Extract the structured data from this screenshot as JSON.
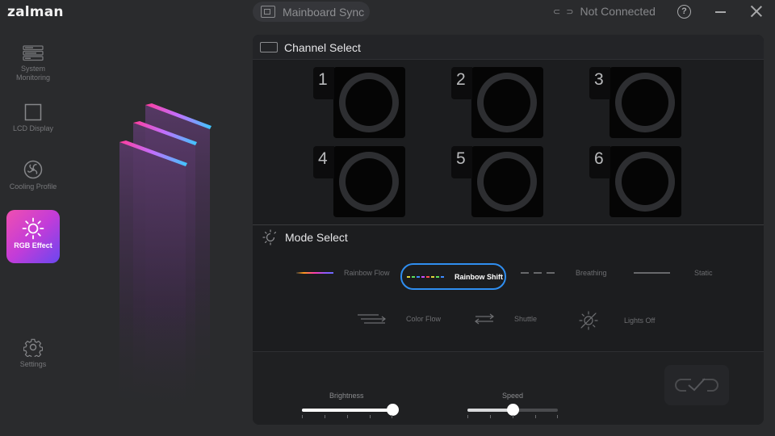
{
  "app": {
    "logo": "zalman",
    "center_title": "Mainboard Sync",
    "connection_status": "Not Connected"
  },
  "sidebar": {
    "items": [
      {
        "label": "System Monitoring",
        "icon": "monitor-bars-icon"
      },
      {
        "label": "LCD Display",
        "icon": "square-icon"
      },
      {
        "label": "Cooling Profile",
        "icon": "fan-icon"
      },
      {
        "label": "RGB Effect",
        "icon": "sun-icon",
        "active": true
      },
      {
        "label": "Settings",
        "icon": "gear-icon"
      }
    ]
  },
  "channel_select": {
    "title": "Channel Select",
    "channels": [
      "1",
      "2",
      "3",
      "4",
      "5",
      "6"
    ]
  },
  "mode_select": {
    "title": "Mode Select",
    "modes": [
      {
        "label": "Rainbow Flow"
      },
      {
        "label": "Rainbow Shift",
        "selected": true
      },
      {
        "label": "Breathing"
      },
      {
        "label": "Static"
      },
      {
        "label": "Color Flow"
      },
      {
        "label": "Shuttle"
      },
      {
        "label": "Lights Off"
      }
    ]
  },
  "controls": {
    "brightness_label": "Brightness",
    "brightness_value": 1.0,
    "speed_label": "Speed",
    "speed_value": 0.5
  },
  "colors": {
    "accent_blue": "#2f8ef0",
    "active_nav_gradient": [
      "#f04fb0",
      "#6a47f0"
    ]
  }
}
